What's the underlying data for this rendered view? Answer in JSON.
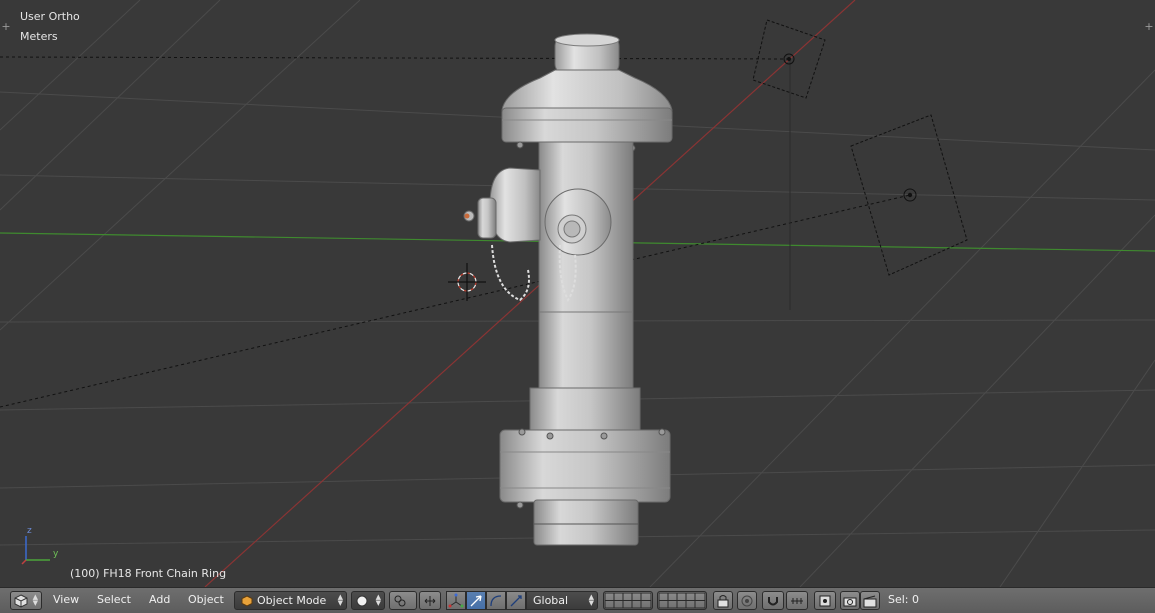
{
  "viewport": {
    "view_name": "User Ortho",
    "units": "Meters",
    "active_object": "(100) FH18 Front Chain Ring",
    "axis_z": "z",
    "axis_y": "y"
  },
  "header": {
    "menu_view": "View",
    "menu_select": "Select",
    "menu_add": "Add",
    "menu_object": "Object",
    "mode": "Object Mode",
    "orientation": "Global",
    "selection": "Sel: 0"
  },
  "colors": {
    "background": "#393939",
    "grid": "#4a4a4a",
    "axis_x": "#8a3434",
    "axis_y": "#3f8a2f",
    "model": "#c8c8c8",
    "header": "#666666",
    "accent_active": "#5680c2"
  }
}
